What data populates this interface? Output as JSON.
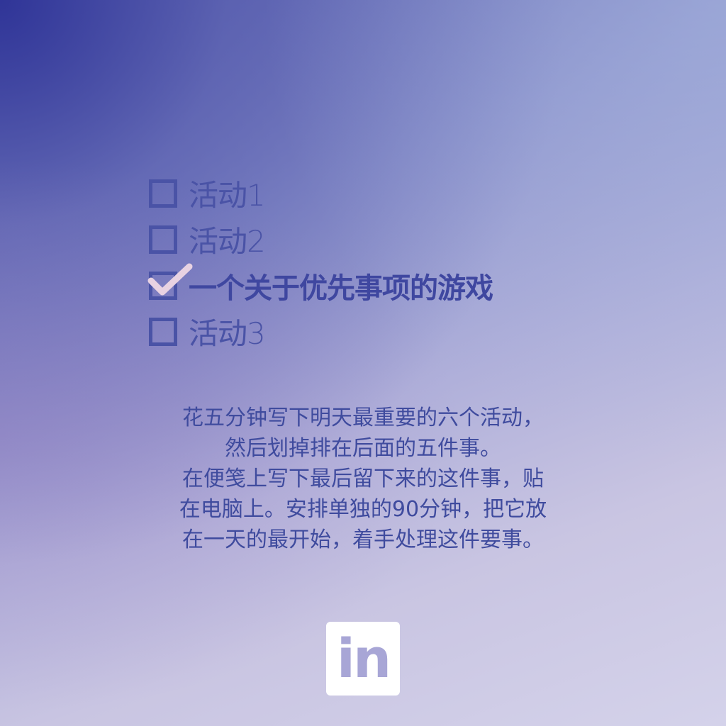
{
  "checklist": {
    "items": [
      {
        "label": "活动1",
        "checked": false
      },
      {
        "label": "活动2",
        "checked": false
      },
      {
        "label": "一个关于优先事项的游戏",
        "checked": true
      },
      {
        "label": "活动3",
        "checked": false
      }
    ]
  },
  "description": {
    "lines": [
      "花五分钟写下明天最重要的六个活动，",
      "然后划掉排在后面的五件事。",
      "在便笺上写下最后留下来的这件事，贴",
      "在电脑上。安排单独的90分钟，把它放",
      "在一天的最开始，着手处理这件要事。"
    ]
  },
  "logo": {
    "text": "in",
    "icon": "linkedin-icon"
  },
  "colors": {
    "text": "#4a53a6",
    "checkmark": "#e6d0e0",
    "logo_bg": "#ffffff"
  }
}
